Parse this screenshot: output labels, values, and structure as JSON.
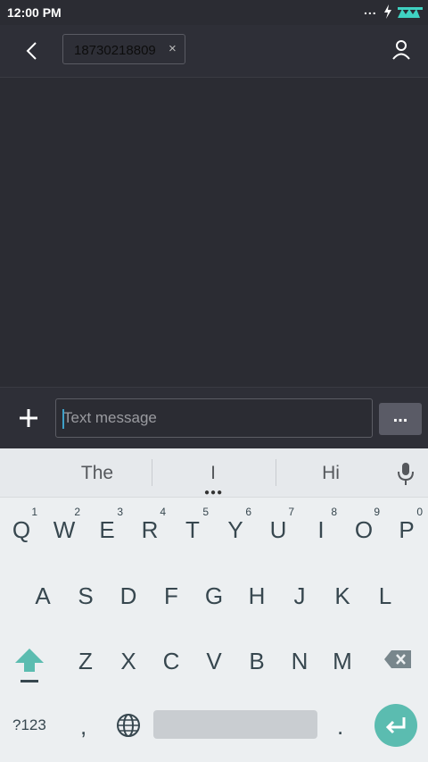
{
  "status_bar": {
    "time": "12:00 PM",
    "dots": "..."
  },
  "header": {
    "recipient": "18730218809",
    "remove_glyph": "×"
  },
  "compose": {
    "placeholder": "Text message",
    "value": "",
    "more_label": "..."
  },
  "keyboard": {
    "suggestions": [
      "The",
      "I",
      "Hi"
    ],
    "row1": [
      {
        "k": "Q",
        "h": "1"
      },
      {
        "k": "W",
        "h": "2"
      },
      {
        "k": "E",
        "h": "3"
      },
      {
        "k": "R",
        "h": "4"
      },
      {
        "k": "T",
        "h": "5"
      },
      {
        "k": "Y",
        "h": "6"
      },
      {
        "k": "U",
        "h": "7"
      },
      {
        "k": "I",
        "h": "8"
      },
      {
        "k": "O",
        "h": "9"
      },
      {
        "k": "P",
        "h": "0"
      }
    ],
    "row2": [
      "A",
      "S",
      "D",
      "F",
      "G",
      "H",
      "J",
      "K",
      "L"
    ],
    "row3": [
      "Z",
      "X",
      "C",
      "V",
      "B",
      "N",
      "M"
    ],
    "symbols_label": "?123",
    "comma": ",",
    "period": "."
  },
  "colors": {
    "accent": "#5bbcb0",
    "background": "#2b2c33",
    "keyboard_bg": "#eceff1"
  },
  "icons": [
    "back-arrow-icon",
    "person-icon",
    "plus-icon",
    "mic-icon",
    "shift-icon",
    "backspace-icon",
    "globe-icon",
    "enter-icon",
    "bolt-icon",
    "signal-icon"
  ]
}
